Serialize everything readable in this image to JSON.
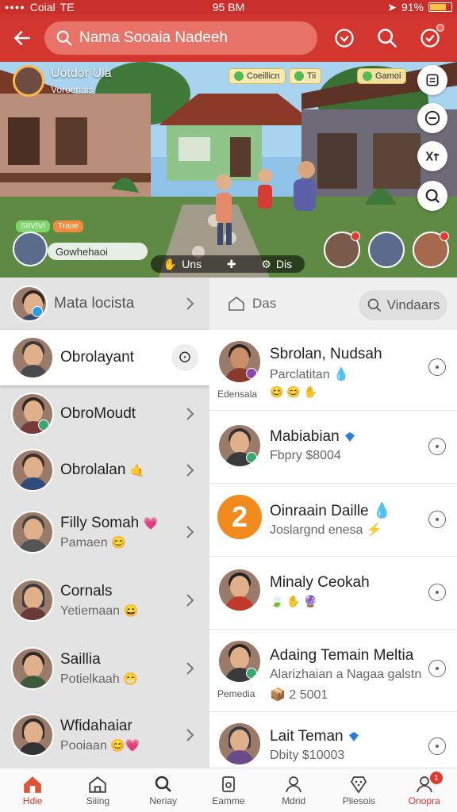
{
  "status_bar": {
    "carrier": "Coial",
    "network": "TE",
    "time": "95 BM",
    "battery": "91%"
  },
  "top_nav": {
    "search_text": "Nama Sooaia Nadeeh"
  },
  "hero": {
    "profile_name": "Uotdor Ula",
    "profile_sub": "Voroenais",
    "chips": [
      "Coeillicn",
      "Tii",
      "Gamoi"
    ],
    "pill_tags": [
      "SIIVIVI",
      "Traoe"
    ],
    "pill_text": "Gowhehaoi",
    "bar_left": "Uns",
    "bar_right": "Dis"
  },
  "left_list": {
    "items": [
      {
        "title": "Mata locista",
        "sub": ""
      },
      {
        "title": "Obrolayant",
        "sub": ""
      },
      {
        "title": "ObroMoudt",
        "sub": ""
      },
      {
        "title": "Obrolalan",
        "sub": ""
      },
      {
        "title": "Filly Somah",
        "sub": "Pamaen"
      },
      {
        "title": "Cornals",
        "sub": "Yetiemaan"
      },
      {
        "title": "Saillia",
        "sub": "Potielkaah"
      },
      {
        "title": "Wfidahaiar",
        "sub": "Pooiaan"
      }
    ]
  },
  "right_list": {
    "header_label": "Das",
    "find_button": "Vindaars",
    "items": [
      {
        "title": "Sbrolan, Nudsah",
        "sub": "Parclatitan",
        "caption": "Edensala",
        "extra": ""
      },
      {
        "title": "Mabiabian",
        "sub": "Fbpry $8004",
        "caption": "",
        "extra": ""
      },
      {
        "title": "Oinraain Daille",
        "sub": "Joslargnd enesa",
        "caption": "",
        "extra": "",
        "badge_number": "2"
      },
      {
        "title": "Minaly Ceokah",
        "sub": "",
        "caption": "",
        "extra": ""
      },
      {
        "title": "Adaing Temain Meltia",
        "sub": "Alarizhaian a Nagaa galstn",
        "caption": "Pemedia",
        "extra": "2 5001"
      },
      {
        "title": "Lait Teman",
        "sub": "Dbity $10003",
        "caption": "",
        "extra": ""
      }
    ]
  },
  "bottom_nav": {
    "items": [
      "Hdie",
      "Siiing",
      "Neriay",
      "Eamme",
      "Mdrid",
      "Pliesois",
      "Onopra"
    ],
    "badge": "1"
  },
  "colors": {
    "brand_red": "#d3362f",
    "accent_orange": "#f28b1e"
  }
}
